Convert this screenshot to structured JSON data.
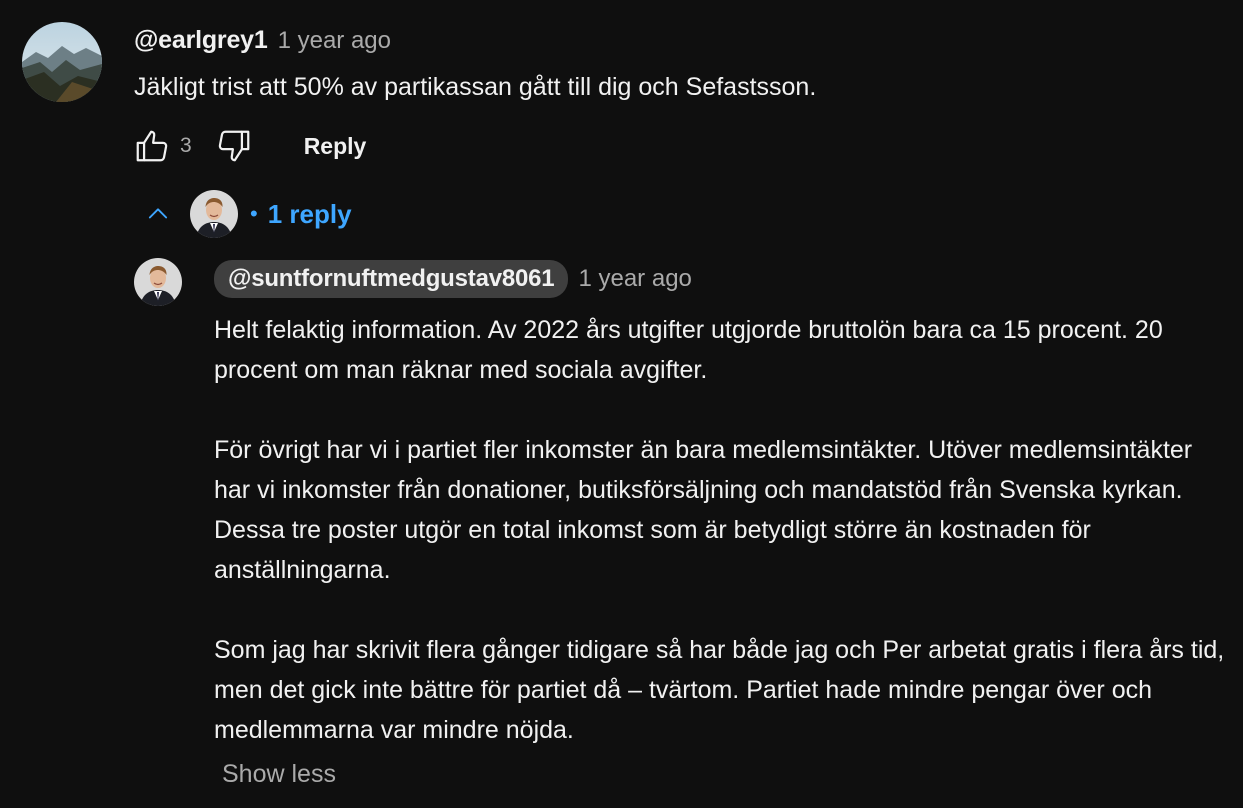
{
  "comment": {
    "handle": "@earlgrey1",
    "time": "1 year ago",
    "text": "Jäkligt trist att 50% av partikassan gått till dig och Sefastsson.",
    "like_count": "3",
    "reply_label": "Reply",
    "avatar_icon": "mountain-landscape-avatar",
    "like_icon": "thumbs-up-icon",
    "dislike_icon": "thumbs-down-icon"
  },
  "replies_toggle": {
    "separator": "•",
    "label": "1 reply",
    "icon": "chevron-up-icon",
    "color": "#3ea6ff"
  },
  "reply": {
    "handle": "@suntfornuftmedgustav8061",
    "time": "1 year ago",
    "paragraphs": [
      "Helt felaktig information. Av 2022 års utgifter utgjorde bruttolön bara ca 15 procent. 20 procent om man räknar med sociala avgifter.",
      "För övrigt har vi i partiet fler inkomster än bara medlemsintäkter. Utöver medlemsintäkter har vi inkomster från donationer, butiksförsäljning och mandatstöd från Svenska kyrkan. Dessa tre poster utgör en total inkomst som är betydligt större än kostnaden för anställningarna.",
      "Som jag har skrivit flera gånger tidigare så har både jag och Per arbetat gratis i flera års tid, men det gick inte bättre för partiet då – tvärtom. Partiet hade mindre pengar över och medlemmarna var mindre nöjda."
    ],
    "show_less_label": "Show less",
    "avatar_icon": "man-in-suit-avatar"
  },
  "colors": {
    "background": "#0f0f0f",
    "text_primary": "#f1f1f1",
    "text_secondary": "#aaaaaa",
    "accent": "#3ea6ff",
    "pill": "#3f3f3f"
  }
}
